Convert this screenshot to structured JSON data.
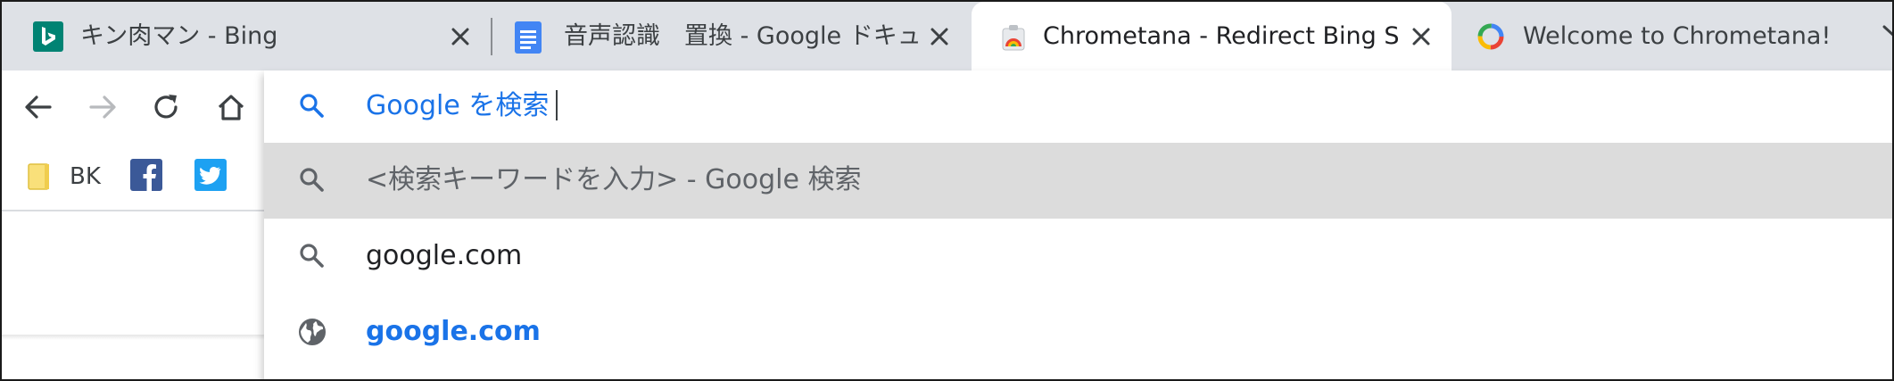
{
  "tabs": [
    {
      "title": "キン肉マン - Bing",
      "favicon": "bing-icon",
      "close": "✕"
    },
    {
      "title": "音声認識　置換 - Google ドキュメント",
      "favicon": "google-docs-icon",
      "close": "✕"
    },
    {
      "title": "Chrometana - Redirect Bing Somewhere Better",
      "favicon": "chrometana-icon",
      "close": "✕",
      "active": true
    },
    {
      "title": "Welcome to Chrometana!",
      "favicon": "chrometana-loading-icon"
    }
  ],
  "toolbar": {
    "back": "back-arrow-icon",
    "forward": "forward-arrow-icon",
    "reload": "reload-icon",
    "home": "home-icon"
  },
  "bookmarks": [
    {
      "label": "BK",
      "icon": "folder-icon"
    },
    {
      "label": "",
      "icon": "facebook-icon"
    },
    {
      "label": "",
      "icon": "twitter-icon"
    }
  ],
  "omnibox": {
    "input_text": "Google を検索",
    "suggestions": [
      {
        "text": "<検索キーワードを入力> - Google 検索",
        "icon": "search-icon",
        "selected": true
      },
      {
        "text": "google.com",
        "icon": "search-icon"
      },
      {
        "text": "google.com",
        "icon": "globe-icon",
        "link": true
      }
    ]
  },
  "colors": {
    "tabstrip": "#dee1e6",
    "accent": "#1a73e8",
    "selected_row": "#dcdcdc"
  }
}
